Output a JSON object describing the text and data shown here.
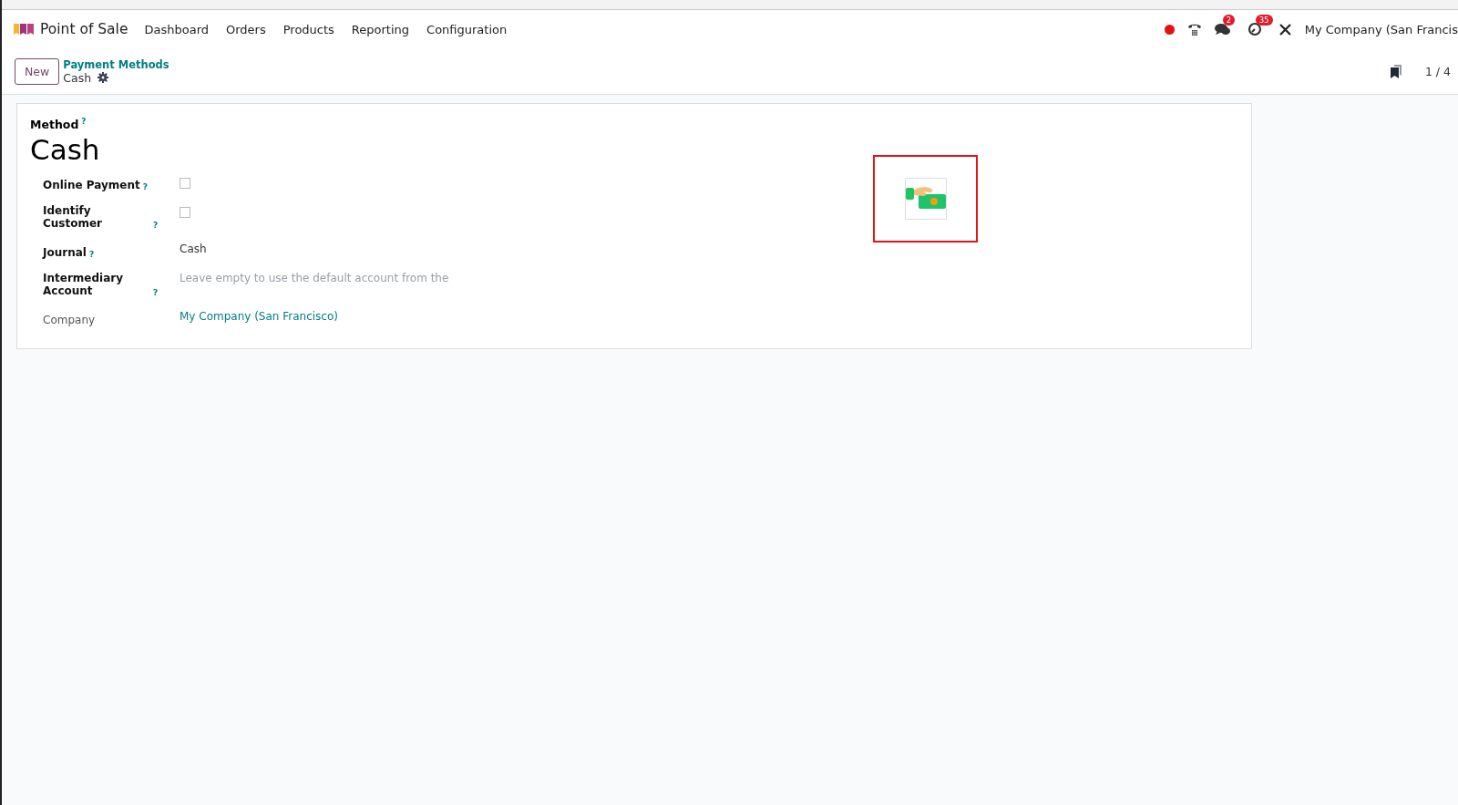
{
  "navbar": {
    "app_name": "Point of Sale",
    "menu": [
      {
        "label": "Dashboard"
      },
      {
        "label": "Orders"
      },
      {
        "label": "Products"
      },
      {
        "label": "Reporting"
      },
      {
        "label": "Configuration"
      }
    ],
    "messages_badge": "2",
    "activities_badge": "35",
    "company": "My Company (San Francis"
  },
  "control_panel": {
    "new_button": "New",
    "breadcrumb": "Payment Methods",
    "record": "Cash",
    "pager": "1 / 4"
  },
  "form": {
    "title_label": "Method",
    "title_help": "?",
    "title": "Cash",
    "fields": [
      {
        "kind": "checkbox",
        "label": "Online Payment",
        "help": "?",
        "checked": false
      },
      {
        "kind": "checkbox",
        "label": "Identify Customer",
        "help": "?",
        "checked": false
      },
      {
        "kind": "text",
        "label": "Journal",
        "help": "?",
        "value": "Cash"
      },
      {
        "kind": "placeholder",
        "label": "Intermediary Account",
        "help": "?",
        "placeholder": "Leave empty to use the default account from the"
      },
      {
        "kind": "link",
        "label": "Company",
        "value": "My Company (San Francisco)"
      }
    ],
    "image": {
      "highlighted": true
    }
  }
}
